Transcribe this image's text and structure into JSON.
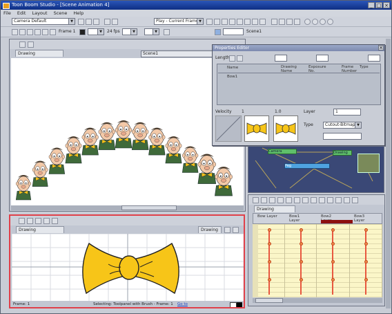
{
  "window": {
    "title": "Toon Boom Studio - [Scene Animation 4]"
  },
  "menu": [
    "File",
    "Edit",
    "Layout",
    "Scene",
    "Help"
  ],
  "toolbar": {
    "layout_combo": "Camera Default",
    "drawing_combo": "Play - Current Frame",
    "frame_label": "Frame 1",
    "fps_label": "24 fps",
    "onion_label": "Onion Skin",
    "scene_label": "Scene1"
  },
  "camera_view": {
    "tab_label": "Drawing",
    "field_label": "Scene1"
  },
  "properties_dialog": {
    "title": "Properties Editor",
    "fields_label": "Length",
    "columns": [
      "Name",
      "Drawing Name",
      "Exposure No.",
      "Frame Number",
      "Type"
    ],
    "row_name": "Bow1",
    "velocity_label": "Velocity",
    "value1": "1",
    "value2": "1.0",
    "layer_label": "Layer",
    "type_label": "Type",
    "type_value": "Cutout-Bitmap",
    "layer_value": "1"
  },
  "network_view": {
    "node1": "Camera",
    "node2": "Drawing",
    "node3": "Peg"
  },
  "exposure_sheet": {
    "tab_label": "Drawing",
    "columns": [
      "Bow Layer",
      "Bow1 Layer",
      "Bow2 Layer",
      "Bow3 Layer"
    ]
  },
  "drawing_view": {
    "tab_label": "Drawing",
    "right_tab": "Drawing",
    "status_left": "Frame: 1",
    "status_center": "Selecting: Toolpanel with Brush - Frame: 1",
    "status_link": "Go to"
  },
  "colors": {
    "accent_red": "#e0404a",
    "bow_yellow": "#f7c518",
    "title_blue": "#1a3f9c"
  }
}
